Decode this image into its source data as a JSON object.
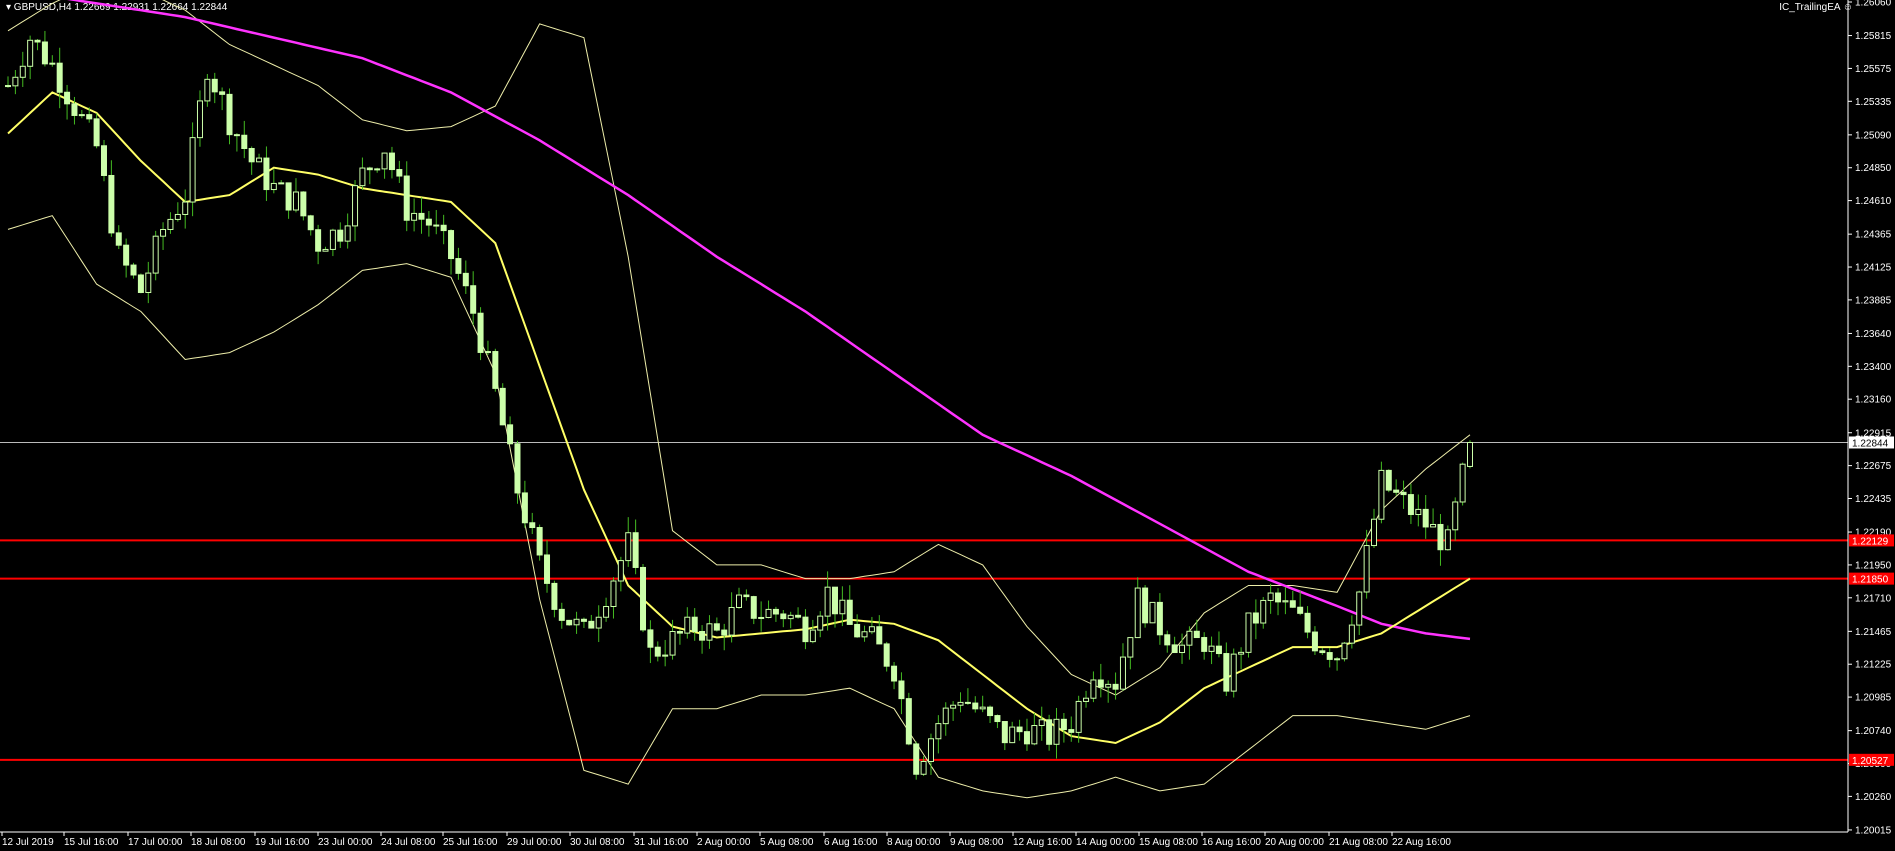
{
  "header": {
    "symbol_line": "▾ GBPUSD,H4  1.22669 1.22931 1.22664 1.22844",
    "ea_name": "IC_TrailingEA ☺"
  },
  "colors": {
    "background": "#000000",
    "bull_candle": "#ccffaa",
    "bear_candle": "#ccffaa",
    "wick": "#44bb22",
    "ma_fast": "#ffff66",
    "ma_slow": "#ff33ff",
    "bands": "#eeeeaa",
    "level_line": "#ff0000",
    "bid_line": "#bbbbbb",
    "axis_text": "#ffffff"
  },
  "chart_data": {
    "type": "candlestick",
    "symbol": "GBPUSD",
    "timeframe": "H4",
    "ohlc_last": {
      "open": 1.22669,
      "high": 1.22931,
      "low": 1.22664,
      "close": 1.22844
    },
    "ylim": [
      1.2,
      1.2606
    ],
    "y_ticks": [
      "1.26060",
      "1.25815",
      "1.25575",
      "1.25335",
      "1.25090",
      "1.24850",
      "1.24610",
      "1.24365",
      "1.24125",
      "1.23885",
      "1.23640",
      "1.23400",
      "1.23160",
      "1.22915",
      "1.22675",
      "1.22435",
      "1.22190",
      "1.21950",
      "1.21710",
      "1.21465",
      "1.21225",
      "1.20985",
      "1.20740",
      "1.20500",
      "1.20260",
      "1.20015"
    ],
    "x_ticks": [
      "12 Jul 2019",
      "15 Jul 16:00",
      "17 Jul 00:00",
      "18 Jul 08:00",
      "19 Jul 16:00",
      "23 Jul 00:00",
      "24 Jul 08:00",
      "25 Jul 16:00",
      "29 Jul 00:00",
      "30 Jul 08:00",
      "31 Jul 16:00",
      "2 Aug 00:00",
      "5 Aug 08:00",
      "6 Aug 16:00",
      "8 Aug 00:00",
      "9 Aug 08:00",
      "12 Aug 16:00",
      "14 Aug 00:00",
      "15 Aug 08:00",
      "16 Aug 16:00",
      "20 Aug 00:00",
      "21 Aug 08:00",
      "22 Aug 16:00"
    ],
    "current_price_label": "1.22844",
    "current_price": 1.22844,
    "horizontal_levels": [
      {
        "label": "1.22129",
        "value": 1.22129
      },
      {
        "label": "1.21850",
        "value": 1.2185
      },
      {
        "label": "1.20527",
        "value": 1.20527
      }
    ],
    "close_path": [
      [
        0,
        1.2545
      ],
      [
        3,
        1.258
      ],
      [
        6,
        1.256
      ],
      [
        9,
        1.253
      ],
      [
        12,
        1.25
      ],
      [
        15,
        1.242
      ],
      [
        18,
        1.2395
      ],
      [
        21,
        1.244
      ],
      [
        24,
        1.2465
      ],
      [
        27,
        1.256
      ],
      [
        30,
        1.252
      ],
      [
        33,
        1.249
      ],
      [
        36,
        1.247
      ],
      [
        39,
        1.246
      ],
      [
        42,
        1.243
      ],
      [
        45,
        1.244
      ],
      [
        48,
        1.248
      ],
      [
        51,
        1.25
      ],
      [
        54,
        1.2455
      ],
      [
        57,
        1.2445
      ],
      [
        60,
        1.242
      ],
      [
        63,
        1.238
      ],
      [
        66,
        1.232
      ],
      [
        69,
        1.225
      ],
      [
        72,
        1.2195
      ],
      [
        75,
        1.216
      ],
      [
        78,
        1.2145
      ],
      [
        81,
        1.2175
      ],
      [
        84,
        1.221
      ],
      [
        87,
        1.213
      ],
      [
        90,
        1.214
      ],
      [
        93,
        1.215
      ],
      [
        96,
        1.2145
      ],
      [
        99,
        1.2165
      ],
      [
        102,
        1.216
      ],
      [
        105,
        1.216
      ],
      [
        108,
        1.215
      ],
      [
        111,
        1.2175
      ],
      [
        114,
        1.215
      ],
      [
        117,
        1.214
      ],
      [
        120,
        1.212
      ],
      [
        123,
        1.205
      ],
      [
        126,
        1.208
      ],
      [
        129,
        1.21
      ],
      [
        132,
        1.2085
      ],
      [
        135,
        1.207
      ],
      [
        138,
        1.2075
      ],
      [
        141,
        1.207
      ],
      [
        144,
        1.208
      ],
      [
        147,
        1.212
      ],
      [
        150,
        1.211
      ],
      [
        153,
        1.217
      ],
      [
        156,
        1.215
      ],
      [
        159,
        1.2135
      ],
      [
        162,
        1.214
      ],
      [
        165,
        1.211
      ],
      [
        168,
        1.215
      ],
      [
        171,
        1.217
      ],
      [
        174,
        1.216
      ],
      [
        177,
        1.214
      ],
      [
        180,
        1.213
      ],
      [
        183,
        1.2175
      ],
      [
        186,
        1.2255
      ],
      [
        189,
        1.224
      ],
      [
        192,
        1.2225
      ],
      [
        195,
        1.221
      ],
      [
        198,
        1.2284
      ]
    ],
    "ma_fast_path": [
      [
        0,
        1.251
      ],
      [
        6,
        1.254
      ],
      [
        12,
        1.2525
      ],
      [
        18,
        1.249
      ],
      [
        24,
        1.246
      ],
      [
        30,
        1.2465
      ],
      [
        36,
        1.2485
      ],
      [
        42,
        1.248
      ],
      [
        48,
        1.247
      ],
      [
        54,
        1.2465
      ],
      [
        60,
        1.246
      ],
      [
        66,
        1.243
      ],
      [
        72,
        1.234
      ],
      [
        78,
        1.225
      ],
      [
        84,
        1.218
      ],
      [
        90,
        1.215
      ],
      [
        96,
        1.2142
      ],
      [
        102,
        1.2145
      ],
      [
        108,
        1.2148
      ],
      [
        114,
        1.2155
      ],
      [
        120,
        1.2152
      ],
      [
        126,
        1.214
      ],
      [
        132,
        1.2115
      ],
      [
        138,
        1.209
      ],
      [
        144,
        1.207
      ],
      [
        150,
        1.2065
      ],
      [
        156,
        1.208
      ],
      [
        162,
        1.2105
      ],
      [
        168,
        1.212
      ],
      [
        174,
        1.2135
      ],
      [
        180,
        1.2135
      ],
      [
        186,
        1.2145
      ],
      [
        192,
        1.2165
      ],
      [
        198,
        1.2185
      ]
    ],
    "ma_slow_path": [
      [
        0,
        1.2615
      ],
      [
        12,
        1.2605
      ],
      [
        24,
        1.2595
      ],
      [
        36,
        1.258
      ],
      [
        48,
        1.2565
      ],
      [
        60,
        1.254
      ],
      [
        72,
        1.2505
      ],
      [
        84,
        1.2465
      ],
      [
        96,
        1.242
      ],
      [
        108,
        1.238
      ],
      [
        120,
        1.2335
      ],
      [
        132,
        1.229
      ],
      [
        144,
        1.226
      ],
      [
        156,
        1.2225
      ],
      [
        168,
        1.219
      ],
      [
        180,
        1.2165
      ],
      [
        186,
        1.2152
      ],
      [
        192,
        1.2145
      ],
      [
        198,
        1.2141
      ]
    ],
    "band_upper_path": [
      [
        0,
        1.2585
      ],
      [
        6,
        1.2605
      ],
      [
        12,
        1.262
      ],
      [
        18,
        1.2615
      ],
      [
        24,
        1.26
      ],
      [
        30,
        1.2575
      ],
      [
        36,
        1.256
      ],
      [
        42,
        1.2545
      ],
      [
        48,
        1.252
      ],
      [
        54,
        1.2512
      ],
      [
        60,
        1.2515
      ],
      [
        66,
        1.253
      ],
      [
        72,
        1.259
      ],
      [
        78,
        1.258
      ],
      [
        84,
        1.242
      ],
      [
        90,
        1.222
      ],
      [
        96,
        1.2195
      ],
      [
        102,
        1.2195
      ],
      [
        108,
        1.2185
      ],
      [
        114,
        1.2185
      ],
      [
        120,
        1.219
      ],
      [
        126,
        1.221
      ],
      [
        132,
        1.2195
      ],
      [
        138,
        1.215
      ],
      [
        144,
        1.2115
      ],
      [
        150,
        1.21
      ],
      [
        156,
        1.212
      ],
      [
        162,
        1.216
      ],
      [
        168,
        1.218
      ],
      [
        174,
        1.218
      ],
      [
        180,
        1.2175
      ],
      [
        186,
        1.2235
      ],
      [
        192,
        1.2265
      ],
      [
        198,
        1.229
      ]
    ],
    "band_lower_path": [
      [
        0,
        1.244
      ],
      [
        6,
        1.245
      ],
      [
        12,
        1.24
      ],
      [
        18,
        1.238
      ],
      [
        24,
        1.2345
      ],
      [
        30,
        1.235
      ],
      [
        36,
        1.2365
      ],
      [
        42,
        1.2385
      ],
      [
        48,
        1.241
      ],
      [
        54,
        1.2415
      ],
      [
        60,
        1.2405
      ],
      [
        66,
        1.2335
      ],
      [
        72,
        1.217
      ],
      [
        78,
        1.2045
      ],
      [
        84,
        1.2035
      ],
      [
        90,
        1.209
      ],
      [
        96,
        1.209
      ],
      [
        102,
        1.21
      ],
      [
        108,
        1.21
      ],
      [
        114,
        1.2105
      ],
      [
        120,
        1.209
      ],
      [
        126,
        1.204
      ],
      [
        132,
        1.203
      ],
      [
        138,
        1.2025
      ],
      [
        144,
        1.203
      ],
      [
        150,
        1.204
      ],
      [
        156,
        1.203
      ],
      [
        162,
        1.2035
      ],
      [
        168,
        1.206
      ],
      [
        174,
        1.2085
      ],
      [
        180,
        1.2085
      ],
      [
        186,
        1.208
      ],
      [
        192,
        1.2075
      ],
      [
        198,
        1.2085
      ]
    ],
    "bars": 199
  }
}
